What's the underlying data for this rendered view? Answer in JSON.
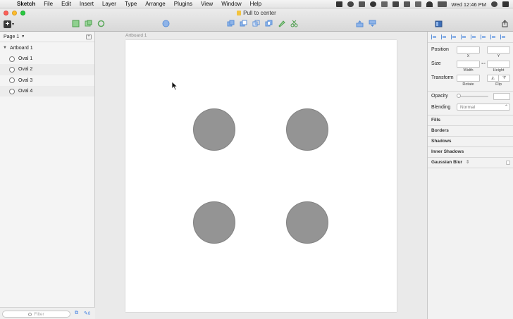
{
  "menubar": {
    "apple_glyph": "",
    "items": [
      "Sketch",
      "File",
      "Edit",
      "Insert",
      "Layer",
      "Type",
      "Arrange",
      "Plugins",
      "View",
      "Window",
      "Help"
    ],
    "clock": "Wed 12:46 PM"
  },
  "window": {
    "title": "Pull to center"
  },
  "layers_panel": {
    "page_label": "Page 1",
    "artboard_label": "Artboard 1",
    "layers": [
      "Oval 1",
      "Oval 2",
      "Oval 3",
      "Oval 4"
    ],
    "filter_placeholder": "Filter",
    "bottom_count": "0"
  },
  "canvas": {
    "artboard_title": "Artboard 1",
    "oval_fill": "#949494",
    "oval_stroke": "#828282"
  },
  "inspector": {
    "position_label": "Position",
    "x_label": "X",
    "y_label": "Y",
    "size_label": "Size",
    "width_label": "Width",
    "height_label": "Height",
    "transform_label": "Transform",
    "rotate_label": "Rotate",
    "flip_label": "Flip",
    "opacity_label": "Opacity",
    "blending_label": "Blending",
    "blending_value": "Normal",
    "sections": [
      "Fills",
      "Borders",
      "Shadows",
      "Inner Shadows",
      "Gaussian Blur"
    ]
  }
}
